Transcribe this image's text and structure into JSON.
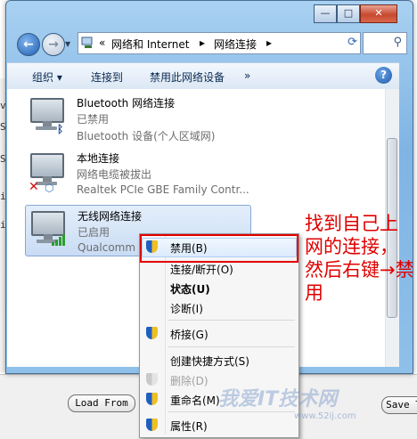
{
  "window": {
    "minimize": "—",
    "maximize": "□",
    "close": "✕"
  },
  "address": {
    "chevron": "«",
    "crumb1": "网络和 Internet",
    "sep1": "▸",
    "crumb2": "网络连接",
    "sep2": "▸"
  },
  "toolbar": {
    "organize": "组织 ▾",
    "connect_to": "连接到",
    "disable_device": "禁用此网络设备",
    "more": "»",
    "help": "?"
  },
  "connections": [
    {
      "name": "Bluetooth 网络连接",
      "status": "已禁用",
      "device": "Bluetooth 设备(个人区域网)"
    },
    {
      "name": "本地连接",
      "status": "网络电缆被拔出",
      "device": "Realtek PCIe GBE Family Contr..."
    },
    {
      "name": "无线网络连接",
      "status": "已启用",
      "device": "Qualcomm A"
    }
  ],
  "context_menu": {
    "items": [
      "禁用(B)",
      "连接/断开(O)",
      "状态(U)",
      "诊断(I)",
      "桥接(G)",
      "创建快捷方式(S)",
      "删除(D)",
      "重命名(M)",
      "属性(R)"
    ]
  },
  "annotation": "找到自己上网的连接，然后右键→禁用",
  "background": {
    "load_button": "Load From",
    "save_button": "Save T"
  },
  "watermark": {
    "main": "我爱IT技术网",
    "url": "www.52ij.com"
  },
  "colors": {
    "accent": "#1f5fc0",
    "annotation": "#e00000",
    "highlight_box": "#e10000"
  }
}
